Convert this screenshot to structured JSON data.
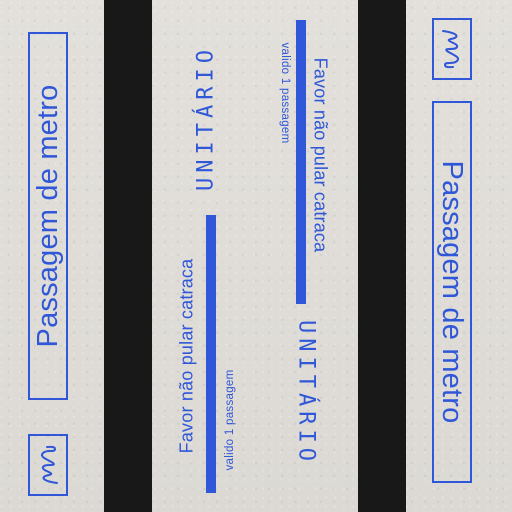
{
  "ticket": {
    "title": "Passagem de metro",
    "warning": "Favor não pular catraca",
    "type": "UNITÁRIO",
    "validity": "valido 1 passagem"
  },
  "colors": {
    "ink_blue": "#2f57d8",
    "stripe_black": "#181818",
    "paper": "#dcd9d4"
  },
  "icons": {
    "logo": "metro-m-scribble-icon"
  }
}
